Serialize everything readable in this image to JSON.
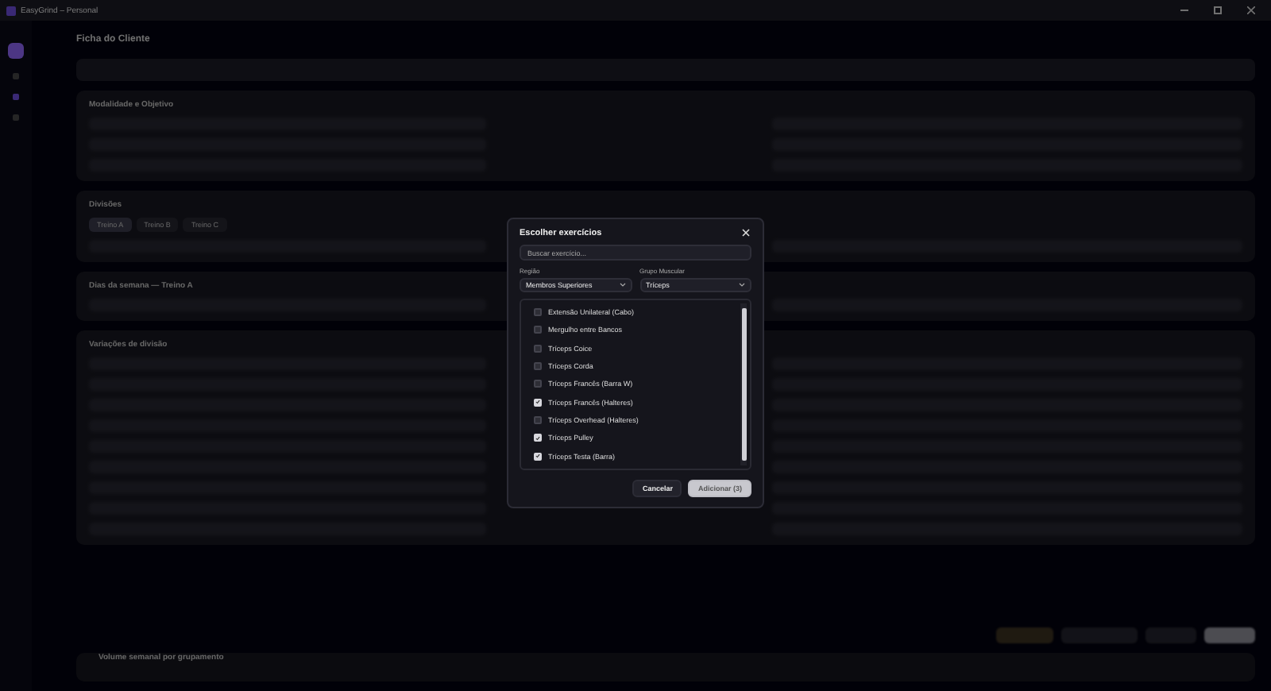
{
  "window": {
    "title": "EasyGrind – Personal"
  },
  "page": {
    "title": "Ficha do Cliente"
  },
  "sections": [
    {
      "title": "Modalidade e Objetivo"
    },
    {
      "title": "Divisões",
      "tabs": [
        {
          "label": "Treino A",
          "selected": true
        },
        {
          "label": "Treino B",
          "selected": false
        },
        {
          "label": "Treino C",
          "selected": false
        }
      ]
    },
    {
      "title": "Dias da semana — Treino A"
    },
    {
      "title": "Variações de divisão"
    }
  ],
  "footer_section": {
    "title": "Volume semanal por grupamento"
  },
  "dialog": {
    "title": "Escolher exercícios",
    "search": {
      "placeholder": "Buscar exercício..."
    },
    "filters": [
      {
        "label": "Região",
        "value": "Membros Superiores"
      },
      {
        "label": "Grupo Muscular",
        "value": "Tríceps"
      }
    ],
    "exercises": [
      {
        "name": "Extensão Unilateral (Cabo)",
        "checked": false
      },
      {
        "name": "Mergulho entre Bancos",
        "checked": false
      },
      {
        "name": "Tríceps Coice",
        "checked": false
      },
      {
        "name": "Tríceps Corda",
        "checked": false
      },
      {
        "name": "Tríceps Francês (Barra W)",
        "checked": false
      },
      {
        "name": "Tríceps Francês (Halteres)",
        "checked": true
      },
      {
        "name": "Tríceps Overhead (Halteres)",
        "checked": false
      },
      {
        "name": "Tríceps Pulley",
        "checked": true
      },
      {
        "name": "Tríceps Testa (Barra)",
        "checked": true
      }
    ],
    "buttons": [
      {
        "label": "Cancelar",
        "kind": "secondary"
      },
      {
        "label": "Adicionar (3)",
        "kind": "primary"
      }
    ]
  }
}
